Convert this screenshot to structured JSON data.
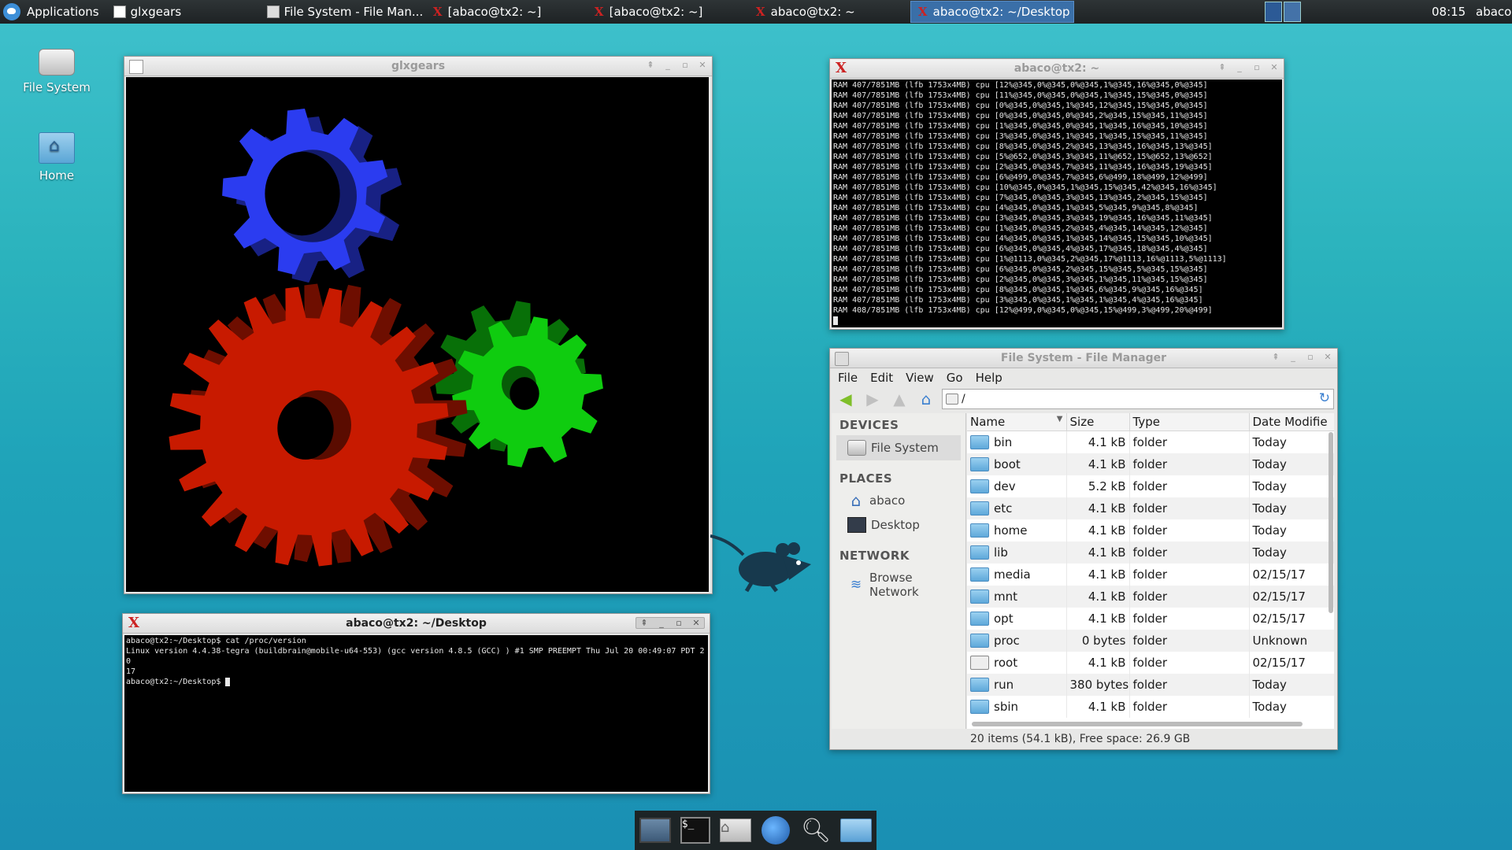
{
  "panel": {
    "applications": "Applications",
    "tasks": [
      "glxgears",
      "File System - File Man...",
      "[abaco@tx2: ~]",
      "[abaco@tx2: ~]",
      "abaco@tx2: ~",
      "abaco@tx2: ~/Desktop"
    ],
    "clock": "08:15",
    "user": "abaco"
  },
  "desktop": {
    "icons": [
      "File System",
      "Home"
    ]
  },
  "glxgears": {
    "title": "glxgears",
    "gear_colors": {
      "red": "#c81a00",
      "green": "#0fcc0f",
      "blue": "#2b3cf0"
    }
  },
  "term_top": {
    "title": "abaco@tx2: ~",
    "lines": [
      "RAM 407/7851MB (lfb 1753x4MB) cpu [12%@345,0%@345,0%@345,1%@345,16%@345,0%@345]",
      "RAM 407/7851MB (lfb 1753x4MB) cpu [11%@345,0%@345,0%@345,1%@345,15%@345,0%@345]",
      "RAM 407/7851MB (lfb 1753x4MB) cpu [0%@345,0%@345,1%@345,12%@345,15%@345,0%@345]",
      "RAM 407/7851MB (lfb 1753x4MB) cpu [0%@345,0%@345,0%@345,2%@345,15%@345,11%@345]",
      "RAM 407/7851MB (lfb 1753x4MB) cpu [1%@345,0%@345,0%@345,1%@345,16%@345,10%@345]",
      "RAM 407/7851MB (lfb 1753x4MB) cpu [3%@345,0%@345,1%@345,1%@345,15%@345,11%@345]",
      "RAM 407/7851MB (lfb 1753x4MB) cpu [8%@345,0%@345,2%@345,13%@345,16%@345,13%@345]",
      "RAM 407/7851MB (lfb 1753x4MB) cpu [5%@652,0%@345,3%@345,11%@652,15%@652,13%@652]",
      "RAM 407/7851MB (lfb 1753x4MB) cpu [2%@345,0%@345,7%@345,11%@345,16%@345,19%@345]",
      "RAM 407/7851MB (lfb 1753x4MB) cpu [6%@499,0%@345,7%@345,6%@499,18%@499,12%@499]",
      "RAM 407/7851MB (lfb 1753x4MB) cpu [10%@345,0%@345,1%@345,15%@345,42%@345,16%@345]",
      "RAM 407/7851MB (lfb 1753x4MB) cpu [7%@345,0%@345,3%@345,13%@345,2%@345,15%@345]",
      "RAM 407/7851MB (lfb 1753x4MB) cpu [4%@345,0%@345,1%@345,5%@345,9%@345,8%@345]",
      "RAM 407/7851MB (lfb 1753x4MB) cpu [3%@345,0%@345,3%@345,19%@345,16%@345,11%@345]",
      "RAM 407/7851MB (lfb 1753x4MB) cpu [1%@345,0%@345,2%@345,4%@345,14%@345,12%@345]",
      "RAM 407/7851MB (lfb 1753x4MB) cpu [4%@345,0%@345,1%@345,14%@345,15%@345,10%@345]",
      "RAM 407/7851MB (lfb 1753x4MB) cpu [6%@345,0%@345,4%@345,17%@345,18%@345,4%@345]",
      "RAM 407/7851MB (lfb 1753x4MB) cpu [1%@1113,0%@345,2%@345,17%@1113,16%@1113,5%@1113]",
      "RAM 407/7851MB (lfb 1753x4MB) cpu [6%@345,0%@345,2%@345,15%@345,5%@345,15%@345]",
      "RAM 407/7851MB (lfb 1753x4MB) cpu [2%@345,0%@345,3%@345,1%@345,11%@345,15%@345]",
      "RAM 407/7851MB (lfb 1753x4MB) cpu [8%@345,0%@345,1%@345,6%@345,9%@345,16%@345]",
      "RAM 407/7851MB (lfb 1753x4MB) cpu [3%@345,0%@345,1%@345,1%@345,4%@345,16%@345]",
      "RAM 408/7851MB (lfb 1753x4MB) cpu [12%@499,0%@345,0%@345,15%@499,3%@499,20%@499]"
    ]
  },
  "term_bottom": {
    "title": "abaco@tx2: ~/Desktop",
    "lines": [
      "abaco@tx2:~/Desktop$ cat /proc/version",
      "Linux version 4.4.38-tegra (buildbrain@mobile-u64-553) (gcc version 4.8.5 (GCC) ) #1 SMP PREEMPT Thu Jul 20 00:49:07 PDT 20",
      "17",
      "abaco@tx2:~/Desktop$ "
    ]
  },
  "file_manager": {
    "title": "File System - File Manager",
    "menu": [
      "File",
      "Edit",
      "View",
      "Go",
      "Help"
    ],
    "location": "/",
    "sidebar": {
      "devices_heading": "DEVICES",
      "devices": [
        "File System"
      ],
      "places_heading": "PLACES",
      "places": [
        "abaco",
        "Desktop"
      ],
      "network_heading": "NETWORK",
      "network": [
        "Browse Network"
      ]
    },
    "columns": [
      "Name",
      "Size",
      "Type",
      "Date Modifie"
    ],
    "rows": [
      {
        "name": "bin",
        "size": "4.1 kB",
        "type": "folder",
        "date": "Today"
      },
      {
        "name": "boot",
        "size": "4.1 kB",
        "type": "folder",
        "date": "Today"
      },
      {
        "name": "dev",
        "size": "5.2 kB",
        "type": "folder",
        "date": "Today"
      },
      {
        "name": "etc",
        "size": "4.1 kB",
        "type": "folder",
        "date": "Today"
      },
      {
        "name": "home",
        "size": "4.1 kB",
        "type": "folder",
        "date": "Today"
      },
      {
        "name": "lib",
        "size": "4.1 kB",
        "type": "folder",
        "date": "Today"
      },
      {
        "name": "media",
        "size": "4.1 kB",
        "type": "folder",
        "date": "02/15/17"
      },
      {
        "name": "mnt",
        "size": "4.1 kB",
        "type": "folder",
        "date": "02/15/17"
      },
      {
        "name": "opt",
        "size": "4.1 kB",
        "type": "folder",
        "date": "02/15/17"
      },
      {
        "name": "proc",
        "size": "0 bytes",
        "type": "folder",
        "date": "Unknown"
      },
      {
        "name": "root",
        "size": "4.1 kB",
        "type": "folder",
        "date": "02/15/17"
      },
      {
        "name": "run",
        "size": "380 bytes",
        "type": "folder",
        "date": "Today"
      },
      {
        "name": "sbin",
        "size": "4.1 kB",
        "type": "folder",
        "date": "Today"
      }
    ],
    "status": "20 items (54.1 kB), Free space: 26.9 GB"
  },
  "dock": {
    "items": [
      "show-desktop-icon",
      "terminal-icon",
      "home-folder-icon",
      "web-browser-icon",
      "app-finder-icon",
      "files-icon"
    ]
  }
}
